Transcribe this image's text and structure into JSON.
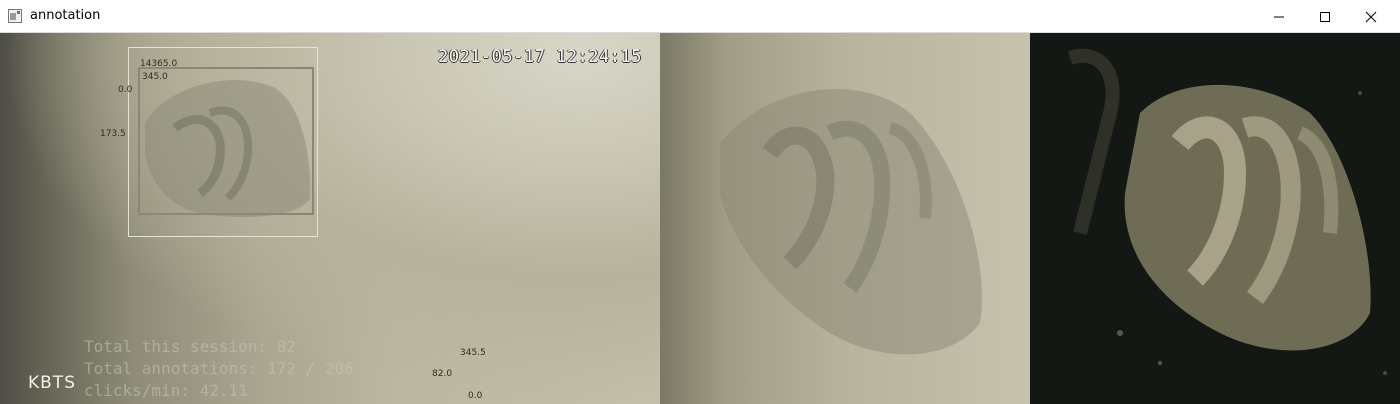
{
  "window": {
    "title": "annotation",
    "controls": {
      "minimize": "minimize-icon",
      "maximize": "maximize-icon",
      "close": "close-icon"
    }
  },
  "left_panel": {
    "timestamp": "2021-05-17 12:24:15",
    "brand": "KBTS",
    "box_labels": {
      "outer_top": "14365.0",
      "inner_top": "345.0",
      "left_mid": "0.0",
      "left_low": "173.5"
    },
    "bottom_labels": {
      "a": "345.5",
      "b": "82.0",
      "c": "0.0"
    },
    "stats": {
      "session": "Total this session: 82",
      "annotations": "Total annotations: 172 / 206",
      "rate": "clicks/min: 42.11"
    }
  }
}
